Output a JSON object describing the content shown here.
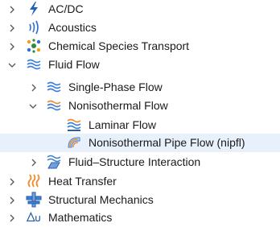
{
  "tree": {
    "nodes": [
      {
        "label": "AC/DC",
        "icon": "acdc-lightning-icon",
        "expander": "collapsed"
      },
      {
        "label": "Acoustics",
        "icon": "acoustics-waves-icon",
        "expander": "collapsed"
      },
      {
        "label": "Chemical Species Transport",
        "icon": "chemical-species-transport-icon",
        "expander": "collapsed"
      },
      {
        "label": "Fluid Flow",
        "icon": "fluid-flow-icon",
        "expander": "expanded"
      },
      {
        "label": "Single-Phase Flow",
        "icon": "single-phase-flow-icon",
        "expander": "collapsed"
      },
      {
        "label": "Nonisothermal Flow",
        "icon": "nonisothermal-flow-icon",
        "expander": "expanded"
      },
      {
        "label": "Laminar Flow",
        "icon": "laminar-flow-icon",
        "expander": "none"
      },
      {
        "label": "Nonisothermal Pipe Flow (nipfl)",
        "icon": "nonisothermal-pipe-flow-icon",
        "expander": "none",
        "selected": true
      },
      {
        "label": "Fluid–Structure Interaction",
        "icon": "fluid-structure-interaction-icon",
        "expander": "collapsed"
      },
      {
        "label": "Heat Transfer",
        "icon": "heat-transfer-icon",
        "expander": "collapsed"
      },
      {
        "label": "Structural Mechanics",
        "icon": "structural-mechanics-icon",
        "expander": "collapsed"
      },
      {
        "label": "Mathematics",
        "icon": "mathematics-icon",
        "expander": "collapsed"
      }
    ]
  },
  "colors": {
    "selection": "#e8f1fb",
    "text": "#1a1a1a",
    "chevron": "#555555",
    "flow_blue": "#3d7fd6",
    "heat_orange": "#f08a2c"
  }
}
